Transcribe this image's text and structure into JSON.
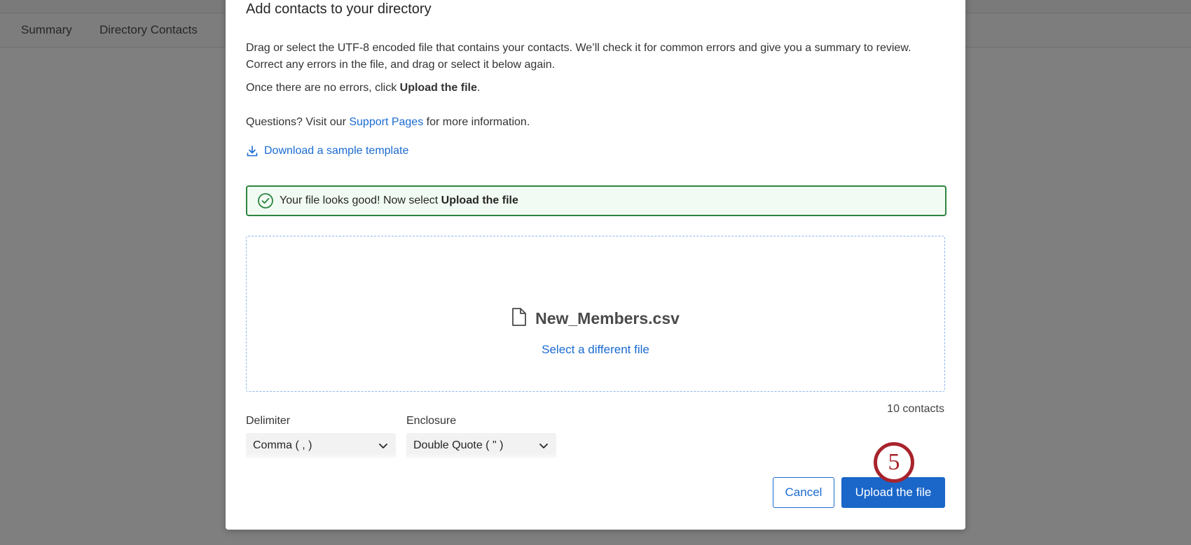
{
  "background": {
    "tabs": [
      {
        "label": "Summary"
      },
      {
        "label": "Directory Contacts"
      }
    ]
  },
  "modal": {
    "title": "Add contacts to your directory",
    "instructions": {
      "line1": "Drag or select the UTF-8 encoded file that contains your contacts. We’ll check it for common errors and give you a summary to review.",
      "line2": "Correct any errors in the file, and drag or select it below again.",
      "line3_prefix": "Once there are no errors, click ",
      "line3_bold": "Upload the file",
      "line3_suffix": ".",
      "questions_prefix": "Questions? Visit our ",
      "questions_link": "Support Pages",
      "questions_suffix": " for more information."
    },
    "download_link": {
      "label": "Download a sample template",
      "icon": "download-icon"
    },
    "success_banner": {
      "icon": "check-circle-icon",
      "text": "Your file looks good! Now select ",
      "bold": "Upload the file",
      "color": "#2e8540"
    },
    "dropzone": {
      "file_icon": "file-icon",
      "file_name": "New_Members.csv",
      "change_link": "Select a different file"
    },
    "contact_count": "10 contacts",
    "delimiter": {
      "label": "Delimiter",
      "value": "Comma ( , )"
    },
    "enclosure": {
      "label": "Enclosure",
      "value": "Double Quote ( \" )"
    },
    "buttons": {
      "cancel": "Cancel",
      "upload": "Upload the file"
    },
    "step_badge": "5"
  },
  "colors": {
    "accent": "#1a6bd1",
    "primary_button": "#1a66c9",
    "success": "#2e8540",
    "step_badge": "#a8232c"
  }
}
